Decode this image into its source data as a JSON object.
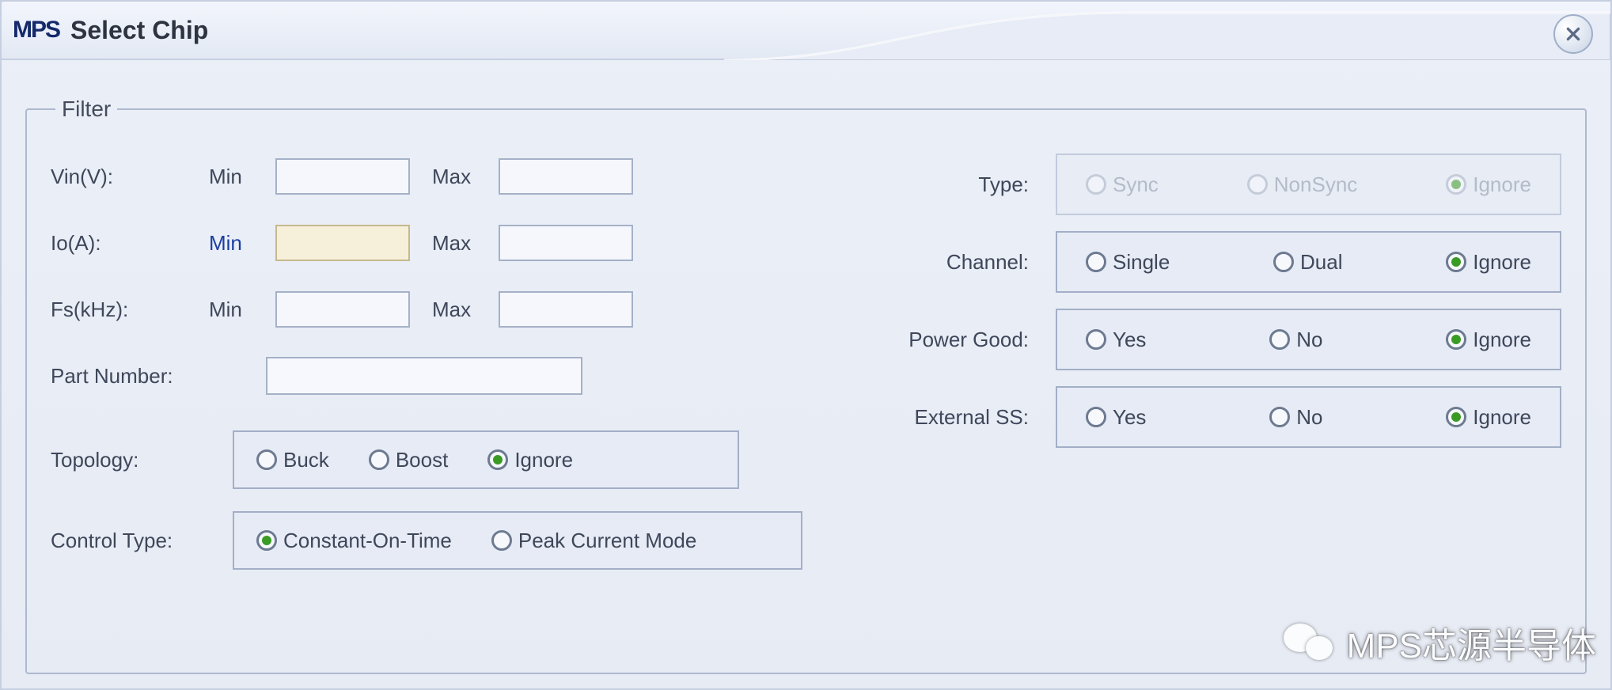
{
  "window": {
    "logo": "MPS",
    "title": "Select Chip"
  },
  "filter": {
    "legend": "Filter",
    "vin": {
      "label": "Vin(V):",
      "minLabel": "Min",
      "maxLabel": "Max",
      "min": "",
      "max": ""
    },
    "io": {
      "label": "Io(A):",
      "minLabel": "Min",
      "maxLabel": "Max",
      "min": "",
      "max": ""
    },
    "fs": {
      "label": "Fs(kHz):",
      "minLabel": "Min",
      "maxLabel": "Max",
      "min": "",
      "max": ""
    },
    "partNumber": {
      "label": "Part Number:",
      "value": ""
    },
    "topology": {
      "label": "Topology:",
      "options": [
        "Buck",
        "Boost",
        "Ignore"
      ],
      "selected": "Ignore"
    },
    "controlType": {
      "label": "Control Type:",
      "options": [
        "Constant-On-Time",
        "Peak Current Mode"
      ],
      "selected": "Constant-On-Time"
    },
    "type": {
      "label": "Type:",
      "options": [
        "Sync",
        "NonSync",
        "Ignore"
      ],
      "selected": "Ignore",
      "disabled": true
    },
    "channel": {
      "label": "Channel:",
      "options": [
        "Single",
        "Dual",
        "Ignore"
      ],
      "selected": "Ignore"
    },
    "powerGood": {
      "label": "Power Good:",
      "options": [
        "Yes",
        "No",
        "Ignore"
      ],
      "selected": "Ignore"
    },
    "externalSS": {
      "label": "External SS:",
      "options": [
        "Yes",
        "No",
        "Ignore"
      ],
      "selected": "Ignore"
    }
  },
  "watermark": "MPS芯源半导体"
}
